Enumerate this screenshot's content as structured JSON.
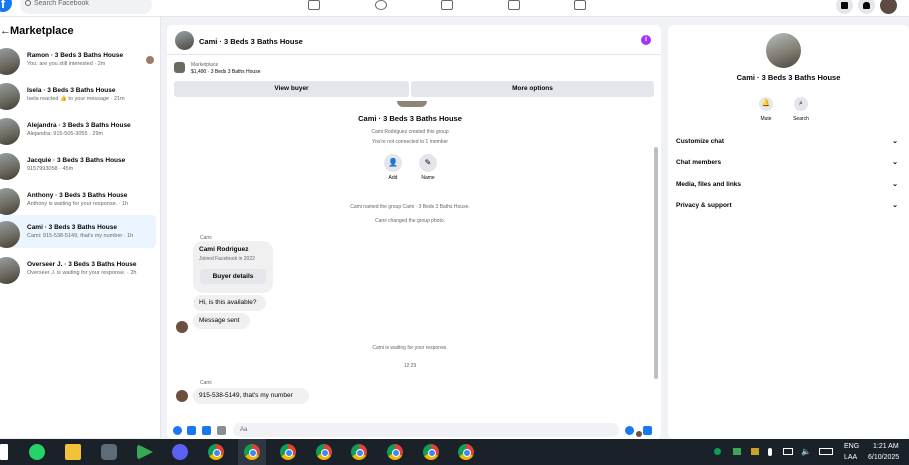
{
  "topbar": {
    "search_placeholder": "Search Facebook"
  },
  "sidebar": {
    "title": "Marketplace",
    "conversations": [
      {
        "title": "Ramon · 3 Beds 3 Baths House",
        "preview": "You: are you still interested · 2m"
      },
      {
        "title": "Isela · 3 Beds 3 Baths House",
        "preview": "Isela reacted 👍 to your message · 21m"
      },
      {
        "title": "Alejandra · 3 Beds 3 Baths House",
        "preview": "Alejandra: 915-505-3055 · 29m"
      },
      {
        "title": "Jacquie · 3 Beds 3 Baths House",
        "preview": "9157993058 · 45m"
      },
      {
        "title": "Anthony · 3 Beds 3 Baths House",
        "preview": "Anthony is waiting for your response. · 1h"
      },
      {
        "title": "Cami · 3 Beds 3 Baths House",
        "preview": "Cami: 915-538-5149, that's my number · 1h"
      },
      {
        "title": "Overseer J. · 3 Beds 3 Baths House",
        "preview": "Overseer J. is waiting for your response. · 2h"
      }
    ]
  },
  "chat": {
    "title": "Cami · 3 Beds 3 Baths House",
    "listing_label": "Marketplace",
    "listing_price": "$1,490 · 3 Beds 3 Baths House",
    "view_buyer": "View buyer",
    "more_options": "More options",
    "group_name": "Cami · 3 Beds 3 Baths House",
    "created": "Cami Rodriguez created this group",
    "connected": "You're not connected to 1 member",
    "add_label": "Add",
    "name_label": "Name",
    "sys1": "Cami named the group Cami · 3 Beds 3 Baths House.",
    "sys2": "Cami changed the group photo.",
    "sender1": "Cami",
    "profile_name": "Cami Rodriguez",
    "profile_joined": "Joined Facebook in 2022",
    "buyer_details": "Buyer details",
    "msg1": "Hi, is this available?",
    "msg2": "Message sent",
    "waiting": "Cami is waiting for your response.",
    "time": "12:29",
    "sender2": "Cami",
    "msg3": "915-538-5149, that's my number",
    "composer_placeholder": "Aa"
  },
  "details": {
    "name": "Cami · 3 Beds 3 Baths House",
    "mute": "Mute",
    "search": "Search",
    "sections": [
      "Customize chat",
      "Chat members",
      "Media, files and links",
      "Privacy & support"
    ]
  },
  "taskbar": {
    "lang1": "ENG",
    "lang2": "LAA",
    "time": "1:21 AM",
    "date": "6/10/2025"
  }
}
